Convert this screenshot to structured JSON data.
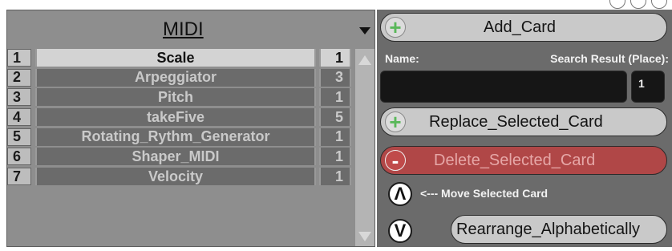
{
  "list": {
    "title": "MIDI",
    "rows": [
      {
        "num": "1",
        "name": "Scale",
        "place": "1"
      },
      {
        "num": "2",
        "name": "Arpeggiator",
        "place": "3"
      },
      {
        "num": "3",
        "name": "Pitch",
        "place": "1"
      },
      {
        "num": "4",
        "name": "takeFive",
        "place": "5"
      },
      {
        "num": "5",
        "name": "Rotating_Rythm_Generator",
        "place": "1"
      },
      {
        "num": "6",
        "name": "Shaper_MIDI",
        "place": "1"
      },
      {
        "num": "7",
        "name": "Velocity",
        "place": "1"
      }
    ]
  },
  "controls": {
    "add_label": "Add_Card",
    "name_label": "Name:",
    "search_label": "Search Result (Place):",
    "name_value": "",
    "search_value": "1",
    "replace_label": "Replace_Selected_Card",
    "delete_label": "Delete_Selected_Card",
    "move_label": "<--- Move Selected Card",
    "up_symbol": "Λ",
    "down_symbol": "V",
    "plus_symbol": "+",
    "minus_symbol": "-",
    "rearrange_label": "Rearrange_Alphabetically"
  }
}
